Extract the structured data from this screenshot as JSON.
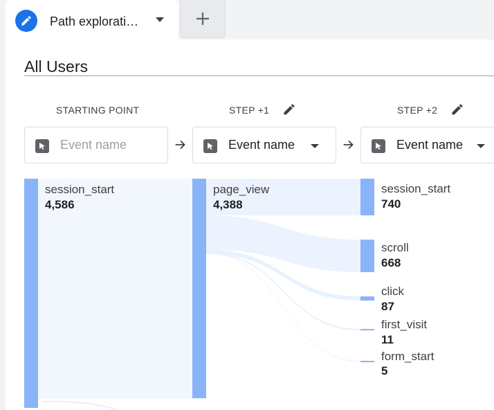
{
  "tab": {
    "title": "Path explorati…"
  },
  "segment": {
    "label": "All Users"
  },
  "columns": [
    {
      "header": "STARTING POINT",
      "selector": "Event name",
      "placeholder": true
    },
    {
      "header": "STEP +1",
      "selector": "Event name",
      "placeholder": false
    },
    {
      "header": "STEP +2",
      "selector": "Event name",
      "placeholder": false
    }
  ],
  "nodes": {
    "start": {
      "label": "session_start",
      "value": "4,586"
    },
    "step1": {
      "label": "page_view",
      "value": "4,388"
    },
    "step2": [
      {
        "label": "session_start",
        "value": "740"
      },
      {
        "label": "scroll",
        "value": "668"
      },
      {
        "label": "click",
        "value": "87"
      },
      {
        "label": "first_visit",
        "value": "11"
      },
      {
        "label": "form_start",
        "value": "5"
      }
    ]
  },
  "colors": {
    "accent": "#1a73e8",
    "node": "#8ab4f8",
    "flow": "#e8f0fe"
  }
}
